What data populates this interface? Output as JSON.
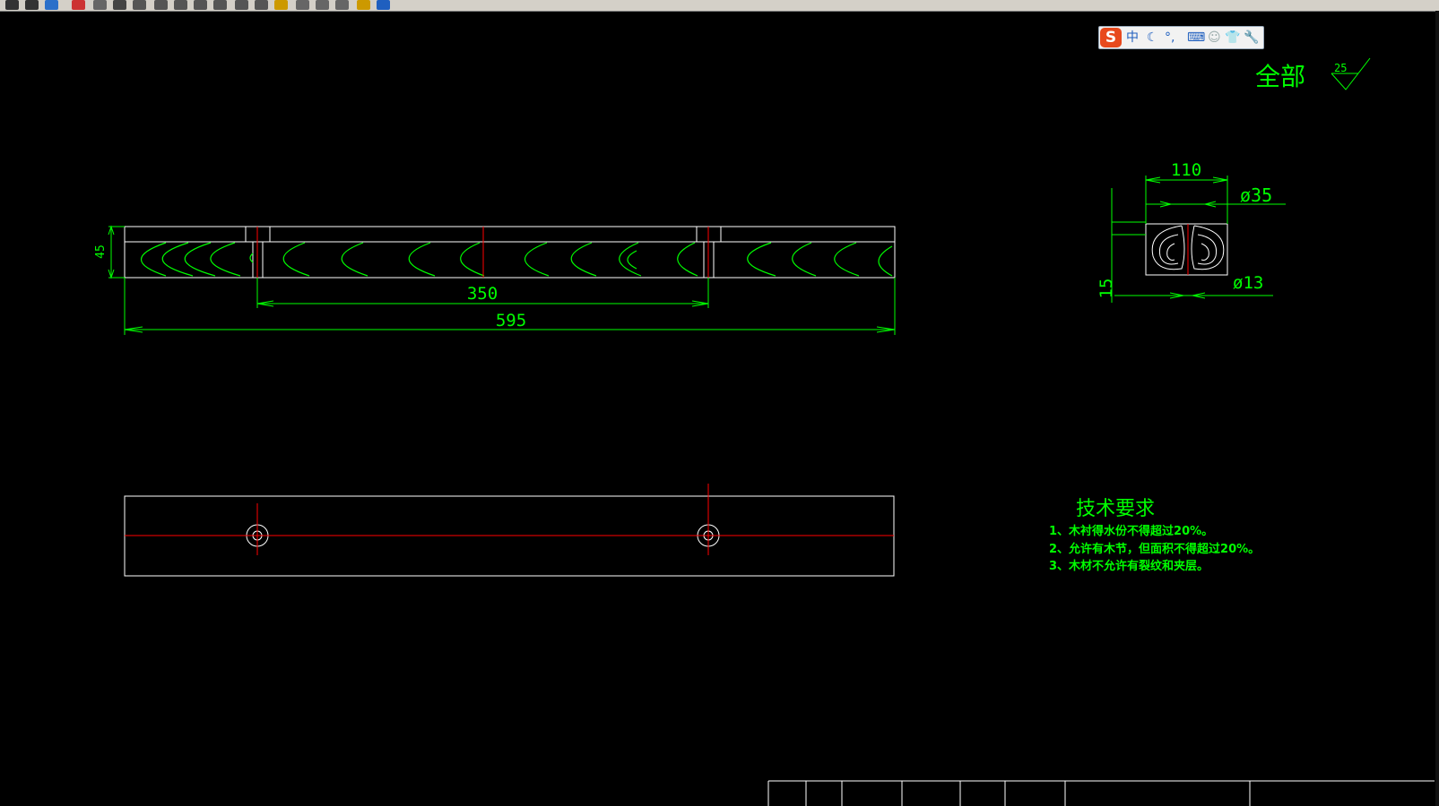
{
  "toolbar": {
    "icons": [
      "save-icon",
      "saveas-icon",
      "plot-icon",
      "cut-icon",
      "copy-icon",
      "print-icon",
      "zoom-in-icon",
      "zoom-out-icon",
      "zoom-window-icon",
      "zoom-realtime-icon",
      "pan-icon",
      "zoom-previous-icon",
      "zoom-extents-icon",
      "properties-icon",
      "design-center-icon",
      "tool-palette-icon",
      "layer-icon",
      "markup-icon",
      "help-icon"
    ]
  },
  "ime": {
    "logo": "S",
    "lang": "中",
    "items": [
      "moon-icon",
      "punctuation-icon",
      "keyboard-icon",
      "user-icon",
      "skin-icon",
      "settings-icon"
    ],
    "mode": "中",
    "punct": "°,"
  },
  "drawing": {
    "roughness": {
      "label": "全部",
      "value": "25"
    },
    "front_view": {
      "dim_length": "595",
      "dim_holes": "350",
      "dim_height": "45"
    },
    "side_view": {
      "dim_width": "110",
      "dim_dia_big": "ø35",
      "dim_dia_small": "ø13",
      "dim_15": "15"
    },
    "tech": {
      "title": "技术要求",
      "lines": [
        "1、木衬得水份不得超过20%。",
        "2、允许有木节，但面积不得超过20%。",
        "3、木材不允许有裂纹和夹层。"
      ]
    }
  },
  "colors": {
    "background": "#000000",
    "geometry": "#ffffff",
    "dimension": "#00ff00",
    "centerline": "#ff0000"
  }
}
